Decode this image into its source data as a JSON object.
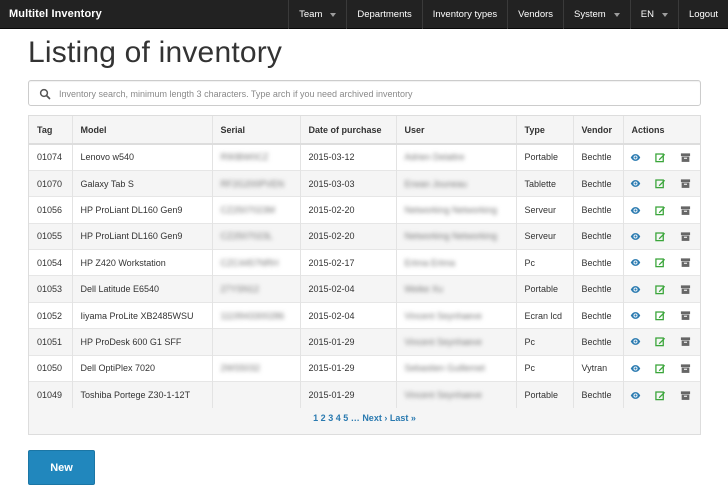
{
  "app": {
    "brand": "Multitel Inventory"
  },
  "nav": [
    {
      "label": "Team",
      "dropdown": true
    },
    {
      "label": "Departments",
      "dropdown": false
    },
    {
      "label": "Inventory types",
      "dropdown": false
    },
    {
      "label": "Vendors",
      "dropdown": false
    },
    {
      "label": "System",
      "dropdown": true
    },
    {
      "label": "EN",
      "dropdown": true
    },
    {
      "label": "Logout",
      "dropdown": false
    }
  ],
  "page": {
    "title": "Listing of inventory"
  },
  "search": {
    "placeholder": "Inventory search, minimum length 3 characters. Type arch if you need archived inventory",
    "value": ""
  },
  "table": {
    "headers": [
      "Tag",
      "Model",
      "Serial",
      "Date of purchase",
      "User",
      "Type",
      "Vendor",
      "Actions"
    ],
    "rows": [
      {
        "tag": "01074",
        "model": "Lenovo w540",
        "serial": "R90BW0CZ",
        "date": "2015-03-12",
        "user": "Adrien Delattre",
        "type": "Portable",
        "vendor": "Bechtle"
      },
      {
        "tag": "01070",
        "model": "Galaxy Tab S",
        "serial": "RF2G200PVEN",
        "date": "2015-03-03",
        "user": "Erwan Jouneau",
        "type": "Tablette",
        "vendor": "Bechtle"
      },
      {
        "tag": "01056",
        "model": "HP ProLiant DL160 Gen9",
        "serial": "CZ2507023M",
        "date": "2015-02-20",
        "user": "Networking Networking",
        "type": "Serveur",
        "vendor": "Bechtle"
      },
      {
        "tag": "01055",
        "model": "HP ProLiant DL160 Gen9",
        "serial": "CZ2507023L",
        "date": "2015-02-20",
        "user": "Networking Networking",
        "type": "Serveur",
        "vendor": "Bechtle"
      },
      {
        "tag": "01054",
        "model": "HP Z420 Workstation",
        "serial": "CZC4457NRH",
        "date": "2015-02-17",
        "user": "Ertma Ertma",
        "type": "Pc",
        "vendor": "Bechtle"
      },
      {
        "tag": "01053",
        "model": "Dell Latitude E6540",
        "serial": "27YSN12",
        "date": "2015-02-04",
        "user": "Weike Xu",
        "type": "Portable",
        "vendor": "Bechtle"
      },
      {
        "tag": "01052",
        "model": "Iiyama ProLite XB2485WSU",
        "serial": "1119943300286",
        "date": "2015-02-04",
        "user": "Vincent Seynhaeve",
        "type": "Ecran lcd",
        "vendor": "Bechtle"
      },
      {
        "tag": "01051",
        "model": "HP ProDesk 600 G1 SFF",
        "serial": "",
        "date": "2015-01-29",
        "user": "Vincent Seynhaeve",
        "type": "Pc",
        "vendor": "Bechtle"
      },
      {
        "tag": "01050",
        "model": "Dell OptiPlex 7020",
        "serial": "2WS5032",
        "date": "2015-01-29",
        "user": "Sebastien Guillemet",
        "type": "Pc",
        "vendor": "Vytran"
      },
      {
        "tag": "01049",
        "model": "Toshiba Portege Z30-1-12T",
        "serial": "",
        "date": "2015-01-29",
        "user": "Vincent Seynhaeve",
        "type": "Portable",
        "vendor": "Bechtle"
      }
    ]
  },
  "pagination": {
    "pages": [
      "1",
      "2",
      "3",
      "4",
      "5"
    ],
    "current": "1",
    "next": "Next ›",
    "last": "Last »"
  },
  "actions": {
    "new_label": "New"
  },
  "icons": {
    "view": "eye-icon",
    "edit": "edit-icon",
    "archive": "archive-icon",
    "search": "search-icon"
  },
  "colors": {
    "navbar": "#222222",
    "link": "#2a7ab0",
    "primary_button": "#2187bd",
    "view_icon": "#2a7ab0",
    "edit_icon": "#3aa53a",
    "archive_icon": "#666666"
  }
}
